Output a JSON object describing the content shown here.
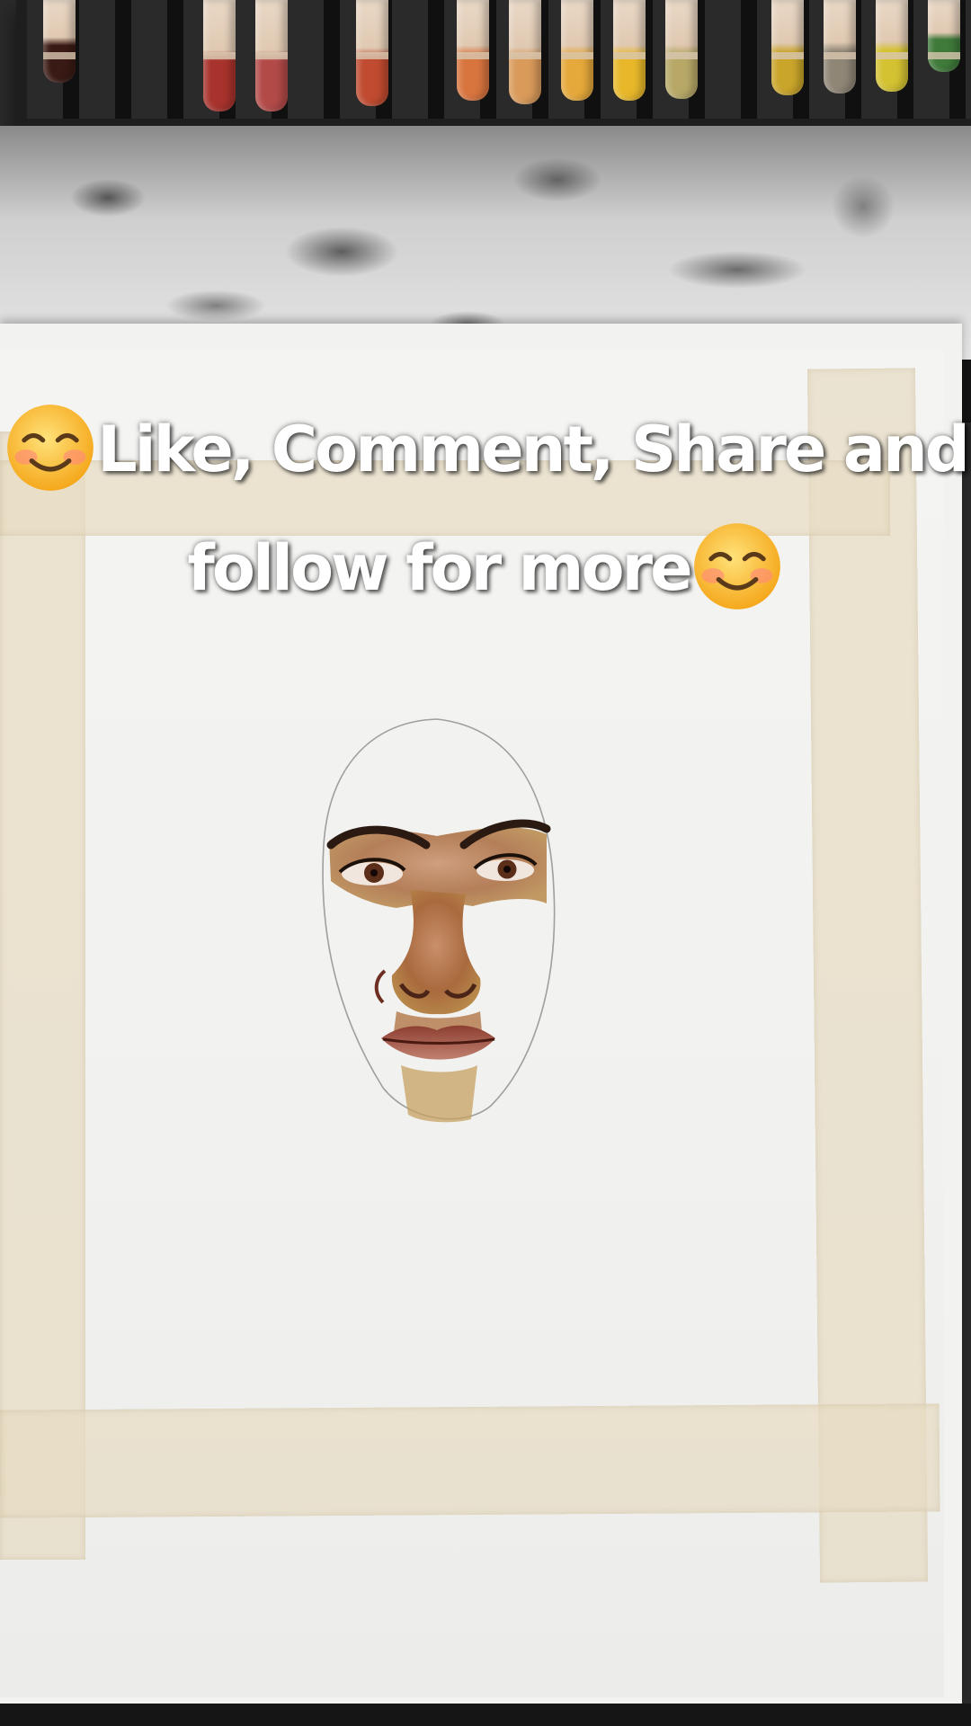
{
  "caption": {
    "line1_text": "Like, Comment, Share and",
    "line2_text": "follow for more",
    "emoji": "smiling-face-with-smiling-eyes"
  },
  "pencils": {
    "colors": [
      "#3a1a14",
      "#a8322c",
      "#b24a48",
      "#c04b30",
      "#d8743e",
      "#d99a5a",
      "#e5a83a",
      "#e8b82a",
      "#b7a867",
      "#c9a52a",
      "#8f8676",
      "#d4c232",
      "#3f7a3a"
    ]
  },
  "colors": {
    "caption_text": "#ffffff",
    "paper": "#f2f2f0",
    "tape": "#e7ddc4",
    "emoji_face": "#ffc83d"
  }
}
